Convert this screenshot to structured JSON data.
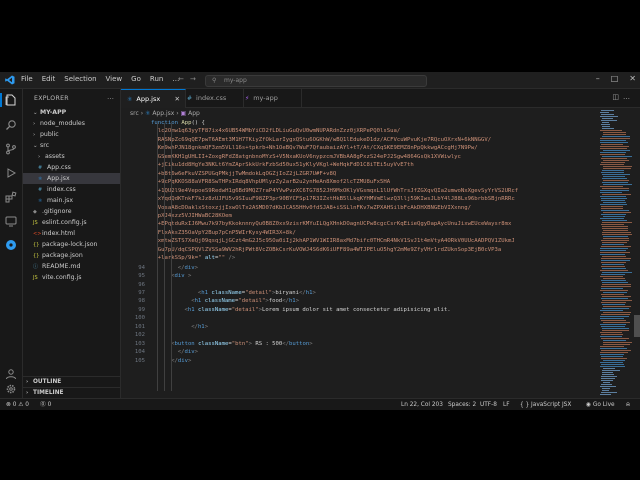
{
  "titlebar": {
    "menu": [
      "File",
      "Edit",
      "Selection",
      "View",
      "Go",
      "Run",
      "…"
    ],
    "search_text": "my-app",
    "window_controls": [
      "–",
      "□",
      "✕"
    ]
  },
  "sidebar": {
    "header": "EXPLORER",
    "more": "…",
    "tree": [
      {
        "label": "MY-APP",
        "kind": "root",
        "chev": "⌄"
      },
      {
        "label": "node_modules",
        "kind": "folder",
        "chev": "›"
      },
      {
        "label": "public",
        "kind": "folder",
        "chev": "›"
      },
      {
        "label": "src",
        "kind": "folder",
        "chev": "⌄"
      },
      {
        "label": "assets",
        "kind": "folder",
        "chev": "›"
      },
      {
        "label": "App.css",
        "kind": "css"
      },
      {
        "label": "App.jsx",
        "kind": "jsx",
        "selected": true
      },
      {
        "label": "index.css",
        "kind": "css"
      },
      {
        "label": "main.jsx",
        "kind": "jsx"
      },
      {
        "label": ".gitignore",
        "kind": "file"
      },
      {
        "label": "eslint.config.js",
        "kind": "js"
      },
      {
        "label": "index.html",
        "kind": "html"
      },
      {
        "label": "package-lock.json",
        "kind": "json"
      },
      {
        "label": "package.json",
        "kind": "json"
      },
      {
        "label": "README.md",
        "kind": "md"
      },
      {
        "label": "vite.config.js",
        "kind": "js"
      }
    ],
    "outline": "OUTLINE",
    "timeline": "TIMELINE"
  },
  "tabs": [
    {
      "label": "App.jsx",
      "active": true
    },
    {
      "label": "index.css",
      "active": false
    },
    {
      "label": "my-app",
      "active": false
    }
  ],
  "tab_close": "✕",
  "breadcrumb": [
    "src",
    "App.jsx",
    "App"
  ],
  "code": {
    "top_lines": [
      "function App() {",
      "  lc2Omw1q63yyTF87ix4x6UB54WMbYiCD2fLDLiuGuQvU0wmNUPARdnZzz0jXRPePQ0lsSua/",
      "  RASNpZc69qQE7pwT6AEmt3M1H7TKiyZfOkLarIygxQStu6OGKhW/wBQ1lEdukeD1dz/ACFVcuWPvuKje7RQcuOXrxN+6kNNGGV/",
      "  Km9whPJN18gnkmQF3zm5VLl16s+tpkrb+Nh1OeBQv7WuF7QfaubaizAYl+tT/At/CXqSKE9EMZ8nPpQkkwgACcgHj7N9Pw/",
      "  GSemKKH1gUHLII+ZoxgRFdZ8atgnbnoMYzS+V5NxaKUoV6nypzcmJVBbAA8gPxzS24ePJ2Sgw4864GsQk1XVWiwlyc",
      "  +jCiku1dd8HgYe3NKLt6YmZAprSkkUrkFzbSd50ux51yKlyVKgl+WeHqkFdD1C8iTEi5uyVvE7th",
      "  +b8t6w6eFkuVZSPUGqPMkjjTwMmdokLqOGZjIoZ2jLZGR7U#F+v8Q",
      "  +9cPqKKOS88aVFR8SwTHPxIRdq8VhpUMlyzZy2arB2u2ynHeAn8Xmof2lcTZMU8uFx5HA",
      "  +1QU2l9e4VepoeS9RedwH1g6Bd9MQZ7raP4YVwPvzXC6TG7852JH9MxOKlyVGsmqxL1lUfWhTrsJfZGXqvQIa2umwoNxXgevSyYrVS2URcf",
      "  xYqdQdKTnkF7kJz8zUJFU5v9SIuuF98ZP3pr90BYCFSp17R3IZxtHkB5lLkqKYHMVmElwzQ3llj59KIwsJLbY4lJ88Lx96brbbSBjnRRRc",
      "  VosaA8cDOaklxStoxzjjIxwOlTx2ASMD07dKbJCAS5HHv0fdSJA8+iSSLlnFKv7wZPXAHSilbFcAkDHXBNGEbVIXxnng/",
      "  pXJ4xzz5VJIHWaBC28KOem",
      "  +EPqtduRxIJ6Mwu7k97byKkoknnnyQu0B8Z0xx9zisrKMYuILQgXHnkDOagnUCPw8cgcCsrKqEiieQgyDapAycUnuJixwEUceWaysr8mx",
      "  FlxAksZ35OaVpY2Bup7pCnP5WIrKysy4WIR3X+8k/",
      "  xmtwZSTS7XeQj09qsqjLjGCzt4mG2J5c95Oa0iIj2khAP1WV1WIIR8axMd7bifc0THCmR4NkV1SvJ1t4mVtyA4ORkV0UUcAADPQV1ZUkmJ",
      "  Gu7pU/dqCSPQVlZVSSa9WV2hRjPWt8VcZOBkCsrKuVOWJ4S6dK6iUFF89a4WTJPEluO5hgY2mMe9ZfyVHr1rdZUknSop3EjB0cVP3a",
      "  +larkSSp/9k=\" alt=\"\" />"
    ],
    "rows": [
      {
        "n": "94",
        "text": "</div>",
        "indent": 4
      },
      {
        "n": "95",
        "text": "<div >",
        "indent": 3
      },
      {
        "n": "96",
        "text": "",
        "indent": 0
      },
      {
        "n": "97",
        "text": "<h1 className=\"detail\">biryani</h1>",
        "indent": 7
      },
      {
        "n": "98",
        "text": "<h1 className=\"detail\">food</h1>",
        "indent": 6
      },
      {
        "n": "99",
        "text": "<h1 className=\"detail\">Lorem ipsum dolor sit amet consectetur adipisicing elit.",
        "indent": 5
      },
      {
        "n": "100",
        "text": "",
        "indent": 0
      },
      {
        "n": "101",
        "text": "</h1>",
        "indent": 6
      },
      {
        "n": "102",
        "text": "",
        "indent": 0
      },
      {
        "n": "103",
        "text": "<button className=\"btn\"> RS : 500</button>",
        "indent": 3
      },
      {
        "n": "104",
        "text": "</div>",
        "indent": 4
      },
      {
        "n": "105",
        "text": "</div>",
        "indent": 3
      }
    ]
  },
  "status": {
    "left": [
      "⊗ 0 ⚠ 0",
      "⓪ 0"
    ],
    "position": "Ln 22, Col 203",
    "spaces": "Spaces: 2",
    "encoding": "UTF-8",
    "eol": "LF",
    "language": "{ } JavaScript JSX",
    "golive": "◉ Go Live",
    "bell": "⍾"
  },
  "colors": {
    "accent": "#0078d4",
    "editor_bg": "#1e1e1e",
    "sidebar_bg": "#181818"
  }
}
